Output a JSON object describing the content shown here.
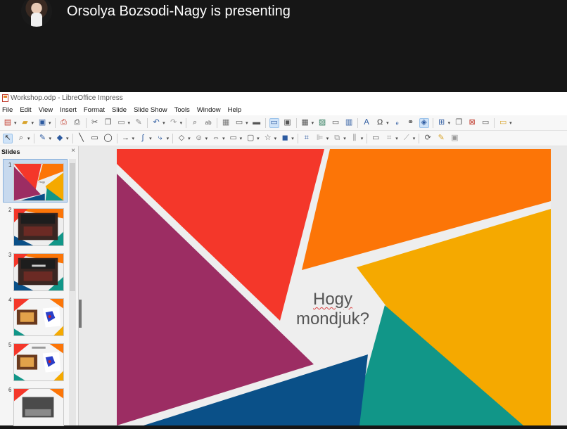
{
  "presenter": {
    "text": "Orsolya Bozsodi-Nagy is presenting"
  },
  "window": {
    "title": "Workshop.odp - LibreOffice Impress"
  },
  "menu": [
    "File",
    "Edit",
    "View",
    "Insert",
    "Format",
    "Slide",
    "Slide Show",
    "Tools",
    "Window",
    "Help"
  ],
  "slides_pane": {
    "header": "Slides",
    "close": "×",
    "slides": [
      {
        "number": "1"
      },
      {
        "number": "2"
      },
      {
        "number": "3"
      },
      {
        "number": "4"
      },
      {
        "number": "5"
      },
      {
        "number": "6"
      }
    ],
    "selected": "1"
  },
  "slide": {
    "title_line1": "Hogy",
    "title_line2": "mondjuk?"
  },
  "colors": {
    "red": "#f4372a",
    "orange": "#fc7507",
    "yellow": "#f5a900",
    "teal": "#119688",
    "blue": "#0a5088",
    "purple": "#9c2d63"
  }
}
